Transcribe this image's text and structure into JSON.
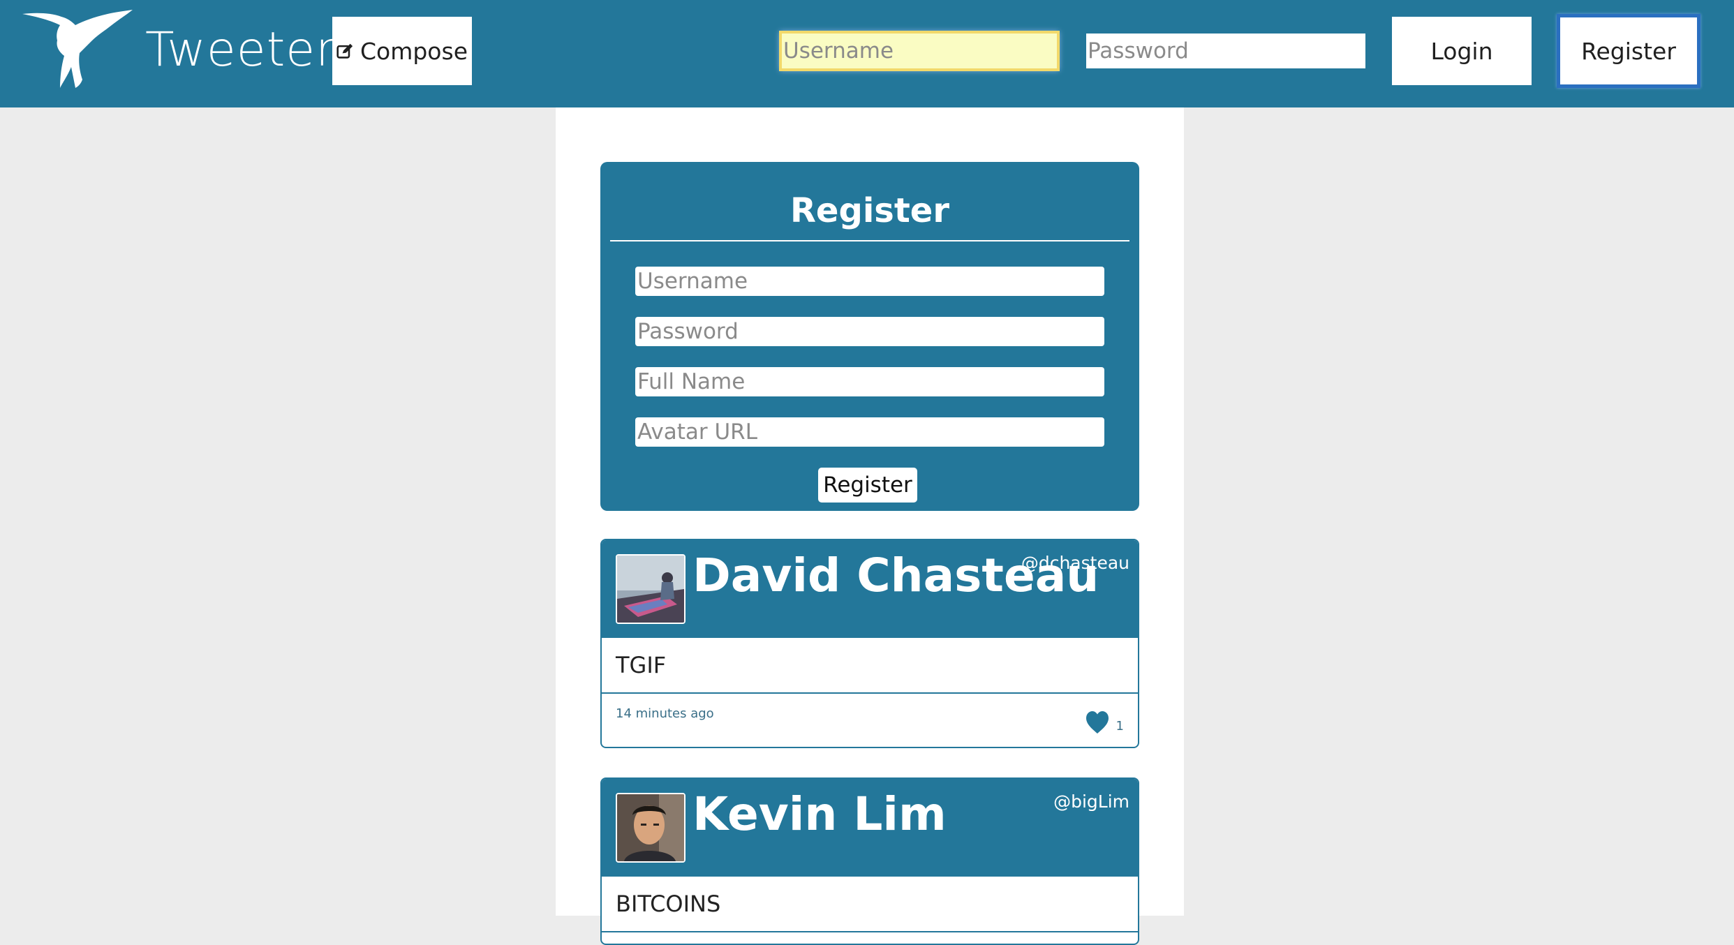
{
  "header": {
    "brand": "Tweeter",
    "compose_label": "Compose",
    "username_placeholder": "Username",
    "password_placeholder": "Password",
    "login_label": "Login",
    "register_label": "Register"
  },
  "register_form": {
    "title": "Register",
    "username_placeholder": "Username",
    "password_placeholder": "Password",
    "fullname_placeholder": "Full Name",
    "avatar_placeholder": "Avatar URL",
    "submit_label": "Register"
  },
  "tweets": [
    {
      "name": "David Chasteau",
      "handle": "@dchasteau",
      "text": "TGIF",
      "time": "14 minutes ago",
      "likes": "1"
    },
    {
      "name": "Kevin Lim",
      "handle": "@bigLim",
      "text": "BITCOINS"
    }
  ],
  "colors": {
    "brand_blue": "#23779a",
    "page_bg": "#ececec"
  }
}
